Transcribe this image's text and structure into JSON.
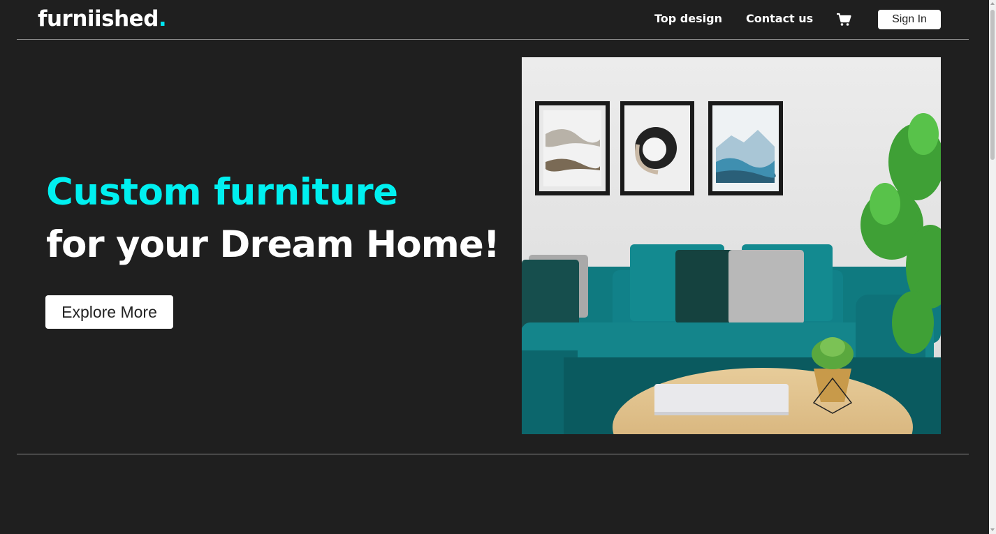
{
  "header": {
    "logo_text": "furniished",
    "logo_dot": ".",
    "nav": [
      {
        "label": "Top design"
      },
      {
        "label": "Contact us"
      }
    ],
    "cart_icon": "cart-icon",
    "signin_label": "Sign In"
  },
  "hero": {
    "headline_accent": "Custom furniture",
    "headline_main": "for your Dream Home!",
    "cta_label": "Explore More",
    "image": "living-room-photo"
  },
  "colors": {
    "background": "#1f1f1f",
    "accent": "#00f0f0",
    "text": "#ffffff"
  }
}
